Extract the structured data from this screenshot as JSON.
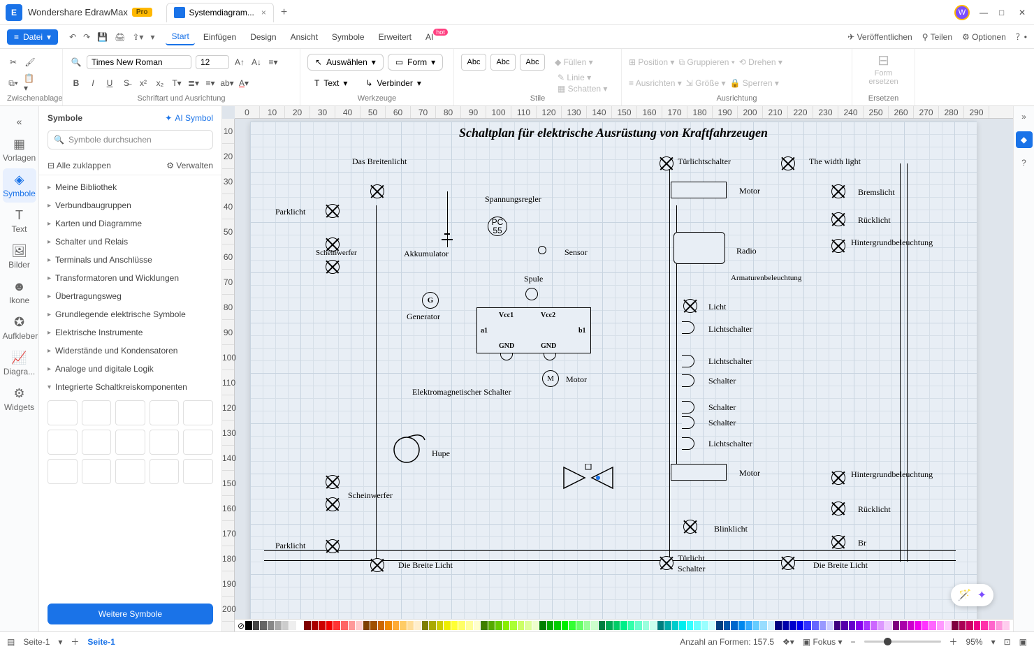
{
  "app": {
    "name": "Wondershare EdrawMax",
    "badge": "Pro",
    "avatar": "W"
  },
  "tabs": {
    "doc_name": "Systemdiagram...",
    "close": "×",
    "add": "+"
  },
  "win": {
    "min": "—",
    "max": "□",
    "close": "✕"
  },
  "file_menu": "Datei",
  "menu": [
    "Start",
    "Einfügen",
    "Design",
    "Ansicht",
    "Symbole",
    "Erweitert",
    "AI"
  ],
  "menu_hot": "hot",
  "topright": {
    "publish": "Veröffentlichen",
    "share": "Teilen",
    "options": "Optionen"
  },
  "ribbon": {
    "clipboard": "Zwischenablage",
    "font": "Schriftart und Ausrichtung",
    "tools": "Werkzeuge",
    "styles": "Stile",
    "align": "Ausrichtung",
    "replace": "Ersetzen",
    "font_name": "Times New Roman",
    "font_size": "12",
    "select": "Auswählen",
    "text": "Text",
    "form": "Form",
    "connector": "Verbinder",
    "abc": "Abc",
    "fill": "Füllen",
    "line": "Linie",
    "shadow": "Schatten",
    "position": "Position",
    "alignbtn": "Ausrichten",
    "group": "Gruppieren",
    "size": "Größe",
    "rotate": "Drehen",
    "lock": "Sperren",
    "replace_btn": "Form ersetzen"
  },
  "leftbar": [
    "Vorlagen",
    "Symbole",
    "Text",
    "Bilder",
    "Ikone",
    "Aufkleber",
    "Diagra...",
    "Widgets"
  ],
  "panel": {
    "title": "Symbole",
    "ai": "AI Symbol",
    "search": "Symbole durchsuchen",
    "collapse": "Alle zuklappen",
    "manage": "Verwalten",
    "libs": [
      "Meine Bibliothek",
      "Verbundbaugruppen",
      "Karten und Diagramme",
      "Schalter und Relais",
      "Terminals und Anschlüsse",
      "Transformatoren und Wicklungen",
      "Übertragungsweg",
      "Grundlegende elektrische Symbole",
      "Elektrische Instrumente",
      "Widerstände und Kondensatoren",
      "Analoge und digitale Logik",
      "Integrierte Schaltkreiskomponenten"
    ],
    "more": "Weitere Symbole"
  },
  "diagram": {
    "title": "Schaltplan für elektrische Ausrüstung von Kraftfahrzeugen",
    "labels": {
      "breitenlicht": "Das Breitenlicht",
      "parklicht": "Parklicht",
      "scheinwerfer": "Scheinwerfer",
      "scheinwerfe": "Scheinwerfer",
      "akkumulator": "Akkumulator",
      "spannungsregler": "Spannungsregler",
      "sensor": "Sensor",
      "pc55": "PC\n55",
      "spule": "Spule",
      "generator": "Generator",
      "g": "G",
      "m": "M",
      "ic": {
        "vcc1": "Vcc1",
        "vcc2": "Vcc2",
        "a1": "a1",
        "b1": "b1",
        "gnd1": "GND",
        "gnd2": "GND"
      },
      "elektroschalter": "Elektromagnetischer Schalter",
      "motor": "Motor",
      "hupe": "Hupe",
      "breite_licht": "Die Breite Licht",
      "tuerlicht": "Türlichtschalter",
      "widthlight": "The width light",
      "bremslicht": "Bremslicht",
      "ruecklicht": "Rücklicht",
      "hintergrund": "Hintergrundbeleuchtung",
      "armaturen": "Armaturenbeleuchtung",
      "radio": "Radio",
      "licht": "Licht",
      "lichtschalter": "Lichtschalter",
      "schalter": "Schalter",
      "blinklicht": "Blinklicht",
      "tuerlichtsch": "Türlicht\nSchalter",
      "br": "Br"
    }
  },
  "status": {
    "page_list": "Seite-1",
    "page_tab": "Seite-1",
    "shapes": "Anzahl an Formen: 157.5",
    "focus": "Fokus",
    "zoom": "95%"
  },
  "colors": [
    "#000",
    "#444",
    "#666",
    "#888",
    "#aaa",
    "#ccc",
    "#eee",
    "#fff",
    "#7f0000",
    "#a00",
    "#c00",
    "#e00",
    "#f33",
    "#f66",
    "#f99",
    "#fcc",
    "#7f3f00",
    "#a05000",
    "#c60",
    "#e80",
    "#fa3",
    "#fc6",
    "#fd9",
    "#fec",
    "#7f7f00",
    "#aa0",
    "#cc0",
    "#ee0",
    "#ff3",
    "#ff6",
    "#ff9",
    "#ffc",
    "#3f7f00",
    "#5a0",
    "#6c0",
    "#8e0",
    "#af3",
    "#cf6",
    "#df9",
    "#efc",
    "#007f00",
    "#0a0",
    "#0c0",
    "#0e0",
    "#3f3",
    "#6f6",
    "#9f9",
    "#cfc",
    "#007f3f",
    "#0a5",
    "#0c6",
    "#0e8",
    "#3fa",
    "#6fc",
    "#9fd",
    "#cfe",
    "#007f7f",
    "#0aa",
    "#0cc",
    "#0ee",
    "#3ff",
    "#6ff",
    "#9ff",
    "#cff",
    "#003f7f",
    "#05a",
    "#06c",
    "#08e",
    "#3af",
    "#6cf",
    "#9df",
    "#cef",
    "#00007f",
    "#00a",
    "#00c",
    "#00e",
    "#33f",
    "#66f",
    "#99f",
    "#ccf",
    "#3f007f",
    "#50a",
    "#60c",
    "#80e",
    "#a3f",
    "#c6f",
    "#d9f",
    "#ecf",
    "#7f007f",
    "#a0a",
    "#c0c",
    "#e0e",
    "#f3f",
    "#f6f",
    "#f9f",
    "#fcf",
    "#7f003f",
    "#a05",
    "#c06",
    "#e08",
    "#f3a",
    "#f6c",
    "#f9d",
    "#fce"
  ]
}
